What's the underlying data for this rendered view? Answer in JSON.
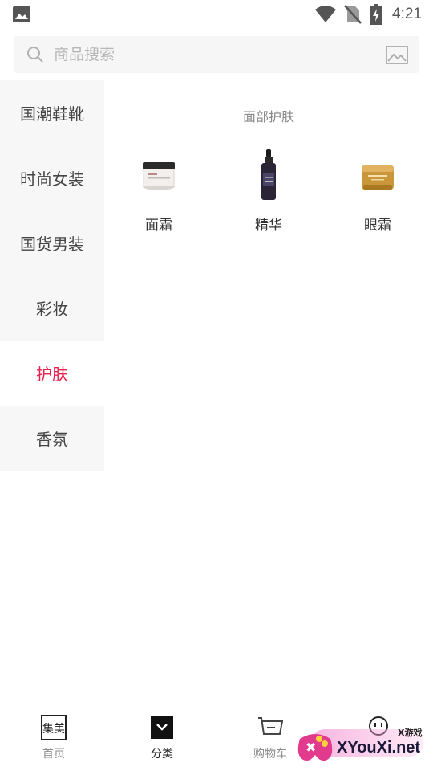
{
  "status_bar": {
    "time": "4:21",
    "icons": [
      "photo-icon",
      "wifi-icon",
      "no-sim-icon",
      "battery-charging-icon"
    ]
  },
  "search": {
    "placeholder": "商品搜索",
    "value": "",
    "icons": [
      "search-icon",
      "image-search-icon"
    ]
  },
  "sidebar": {
    "items": [
      {
        "label": "国潮鞋靴",
        "active": false
      },
      {
        "label": "时尚女装",
        "active": false
      },
      {
        "label": "国货男装",
        "active": false
      },
      {
        "label": "彩妆",
        "active": false
      },
      {
        "label": "护肤",
        "active": true
      },
      {
        "label": "香氛",
        "active": false
      }
    ]
  },
  "content": {
    "section_title": "面部护肤",
    "products": [
      {
        "label": "面霜",
        "icon": "face-cream-jar-icon"
      },
      {
        "label": "精华",
        "icon": "serum-bottle-icon"
      },
      {
        "label": "眼霜",
        "icon": "eye-cream-jar-icon"
      }
    ]
  },
  "bottom_nav": {
    "items": [
      {
        "label": "首页",
        "icon": "home-logo-icon",
        "active": false
      },
      {
        "label": "分类",
        "icon": "category-bag-icon",
        "active": true
      },
      {
        "label": "购物车",
        "icon": "cart-icon",
        "active": false
      }
    ]
  },
  "watermark": {
    "small_text": "X游戏",
    "text": "XYouXi.net"
  },
  "colors": {
    "accent": "#e8234f",
    "sidebar_bg": "#f7f7f7",
    "search_bg": "#f6f6f6"
  }
}
